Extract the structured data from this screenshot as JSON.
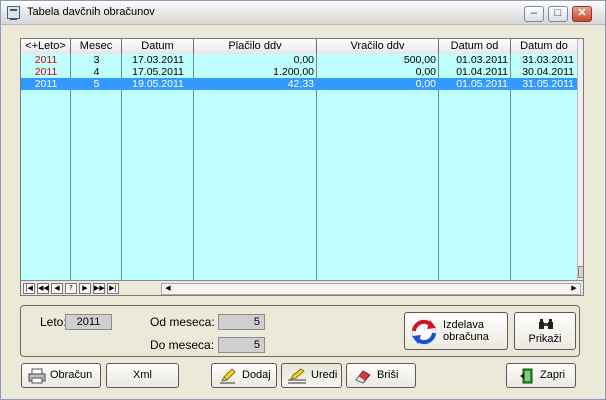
{
  "window": {
    "title": "Tabela davčnih obračunov"
  },
  "grid": {
    "columns": [
      "<+Leto>",
      "Mesec",
      "Datum",
      "Plačilo ddv",
      "Vračilo ddv",
      "Datum od",
      "Datum do"
    ],
    "rows": [
      {
        "leto": "2011",
        "mesec": "3",
        "datum": "17.03.2011",
        "placilo": "0,00",
        "vracilo": "500,00",
        "od": "01.03.2011",
        "do": "31.03.2011",
        "selected": false
      },
      {
        "leto": "2011",
        "mesec": "4",
        "datum": "17.05.2011",
        "placilo": "1.200,00",
        "vracilo": "0,00",
        "od": "01.04.2011",
        "do": "30.04.2011",
        "selected": false
      },
      {
        "leto": "2011",
        "mesec": "5",
        "datum": "19.05.2011",
        "placilo": "42,33",
        "vracilo": "0,00",
        "od": "01.05.2011",
        "do": "31.05.2011",
        "selected": true
      }
    ],
    "nav_buttons": [
      "|◀",
      "◀◀",
      "◀",
      "?",
      "▶",
      "▶▶",
      "▶|"
    ]
  },
  "filter": {
    "leto_label": "Leto:",
    "leto_value": "2011",
    "od_meseca_label": "Od meseca:",
    "od_meseca_value": "5",
    "do_meseca_label": "Do meseca:",
    "do_meseca_value": "5"
  },
  "actions": {
    "izdelava_line1": "Izdelava",
    "izdelava_line2": "obračuna",
    "prikazi": "Prikaži"
  },
  "buttons": {
    "obracun": "Obračun",
    "xml": "Xml",
    "dodaj": "Dodaj",
    "uredi": "Uredi",
    "brisi": "Briši",
    "zapri": "Zapri"
  },
  "colors": {
    "grid_background": "#c0ffff",
    "selection": "#3399ff",
    "year_text": "#d00000"
  }
}
